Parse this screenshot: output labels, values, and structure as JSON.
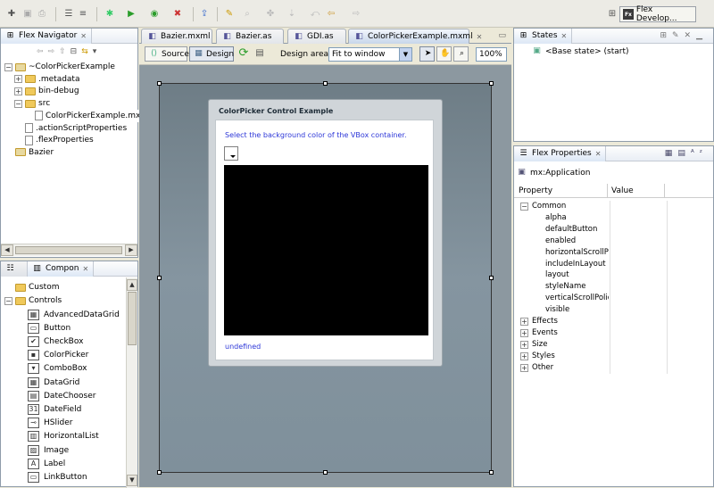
{
  "toolbar": {
    "icons": [
      "new-icon",
      "save-icon",
      "print-icon",
      "outline-icon",
      "format-icon",
      "debug-icon",
      "run-icon",
      "profile-icon",
      "external-tools-icon",
      "export-icon",
      "build-icon",
      "search-icon",
      "ant-icon",
      "nav-back-icon",
      "nav-forward-icon"
    ],
    "perspective_label": "Flex Develop..."
  },
  "navigator": {
    "tab_label": "Flex Navigator",
    "items": [
      {
        "label": "~ColorPickerExample",
        "indent": 0
      },
      {
        "label": ".metadata",
        "indent": 1
      },
      {
        "label": "bin-debug",
        "indent": 1
      },
      {
        "label": "src",
        "indent": 1
      },
      {
        "label": "ColorPickerExample.mxml",
        "indent": 2
      },
      {
        "label": ".actionScriptProperties",
        "indent": 1
      },
      {
        "label": ".flexProperties",
        "indent": 1
      },
      {
        "label": "Bazier",
        "indent": 0
      }
    ]
  },
  "components": {
    "tab_label": "Compon",
    "folders": [
      "Custom",
      "Controls"
    ],
    "items": [
      {
        "label": "AdvancedDataGrid",
        "glyph": "▦"
      },
      {
        "label": "Button",
        "glyph": "▭"
      },
      {
        "label": "CheckBox",
        "glyph": "✔"
      },
      {
        "label": "ColorPicker",
        "glyph": "▪"
      },
      {
        "label": "ComboBox",
        "glyph": "▾"
      },
      {
        "label": "DataGrid",
        "glyph": "▦"
      },
      {
        "label": "DateChooser",
        "glyph": "▤"
      },
      {
        "label": "DateField",
        "glyph": "31"
      },
      {
        "label": "HSlider",
        "glyph": "⊸"
      },
      {
        "label": "HorizontalList",
        "glyph": "▥"
      },
      {
        "label": "Image",
        "glyph": "▨"
      },
      {
        "label": "Label",
        "glyph": "A"
      },
      {
        "label": "LinkButton",
        "glyph": "▭"
      }
    ]
  },
  "editor": {
    "tabs": [
      "Bazier.mxml",
      "Bazier.as",
      "GDI.as",
      "ColorPickerExample.mxml"
    ],
    "active_tab_index": 3,
    "source_label": "Source",
    "design_label": "Design",
    "design_area_label": "Design area:",
    "design_area_value": "Fit to window",
    "zoom_value": "100%"
  },
  "canvas": {
    "panel_title": "ColorPicker Control Example",
    "instruction": "Select the background color of the VBox container.",
    "status_text": "undefined",
    "vbox_color": "#000000"
  },
  "states": {
    "tab_label": "States",
    "items": [
      "<Base state> (start)"
    ]
  },
  "properties": {
    "tab_label": "Flex Properties",
    "component": "mx:Application",
    "col_property": "Property",
    "col_value": "Value",
    "common_label": "Common",
    "common_items": [
      "alpha",
      "defaultButton",
      "enabled",
      "horizontalScrollPol",
      "includeInLayout",
      "layout",
      "styleName",
      "verticalScrollPolicy",
      "visible"
    ],
    "groups": [
      "Effects",
      "Events",
      "Size",
      "Styles",
      "Other"
    ]
  },
  "colors": {
    "accent": "#2d37d8",
    "panel_border": "#8f9caa",
    "canvas_bg": "#7f909b"
  }
}
